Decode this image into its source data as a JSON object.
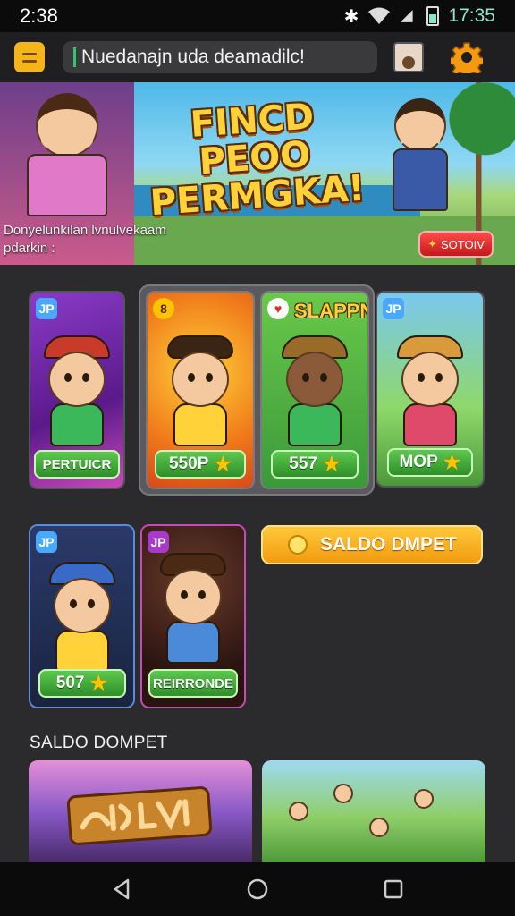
{
  "status_bar": {
    "time_left": "2:38",
    "time_right": "17:35"
  },
  "app_bar": {
    "search_text": "Nuedanajn uda deamadilc!"
  },
  "banner": {
    "title_line1": "FINCD PEOO",
    "title_line2": "PERMGKA!",
    "subtitle_line1": "Donyelunkilan lvnulvekaam",
    "subtitle_line2": "pdarkin :",
    "button_label": "SOTOIV"
  },
  "game_cards_row1": [
    {
      "badge": "JP",
      "chip": "PERTUICR",
      "chip_star": false
    },
    {
      "badge": "8",
      "chip": "550P",
      "chip_star": true
    },
    {
      "title": "SLAPPN",
      "badge": "♥",
      "chip": "557",
      "chip_star": true
    },
    {
      "badge": "JP",
      "chip": "MOP",
      "chip_star": true
    }
  ],
  "game_cards_row2": [
    {
      "badge": "JP",
      "chip": "507",
      "chip_star": true
    },
    {
      "badge": "JP",
      "chip": "REIRRONDE",
      "chip_star": false
    }
  ],
  "cta_button": {
    "label": "SALDO DMPET"
  },
  "section": {
    "title": "SALDO DOMPET"
  },
  "colors": {
    "accent_orange": "#f39a10",
    "chip_green": "#2f8f2a",
    "banner_button_red": "#c21a1a",
    "background": "#2b2b2d"
  }
}
